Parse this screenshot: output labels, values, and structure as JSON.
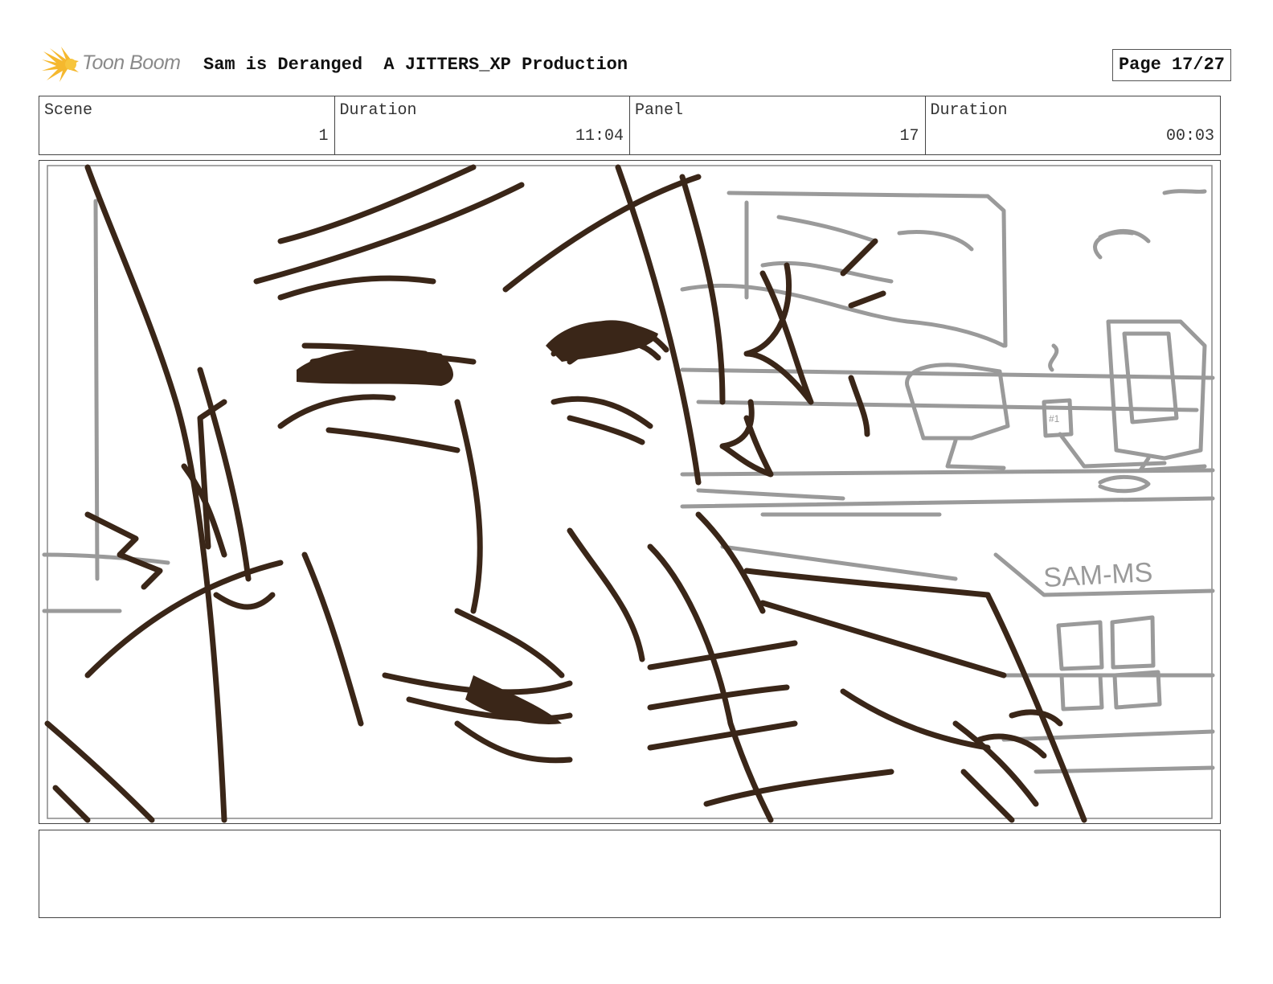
{
  "header": {
    "logo_text": "Toon Boom",
    "project_title": "Sam is Deranged  A JITTERS_XP Production",
    "page_label": "Page 17/27"
  },
  "info_table": {
    "cells": [
      {
        "label": "Scene",
        "value": "1"
      },
      {
        "label": "Duration",
        "value": "11:04"
      },
      {
        "label": "Panel",
        "value": "17"
      },
      {
        "label": "Duration",
        "value": "00:03"
      }
    ]
  },
  "panel": {
    "sign_text": "SAM-MS",
    "mug_text": "#1",
    "ink_color": "#3a2618",
    "background_line_color": "#9a9a9a"
  },
  "notes": {
    "text": ""
  }
}
